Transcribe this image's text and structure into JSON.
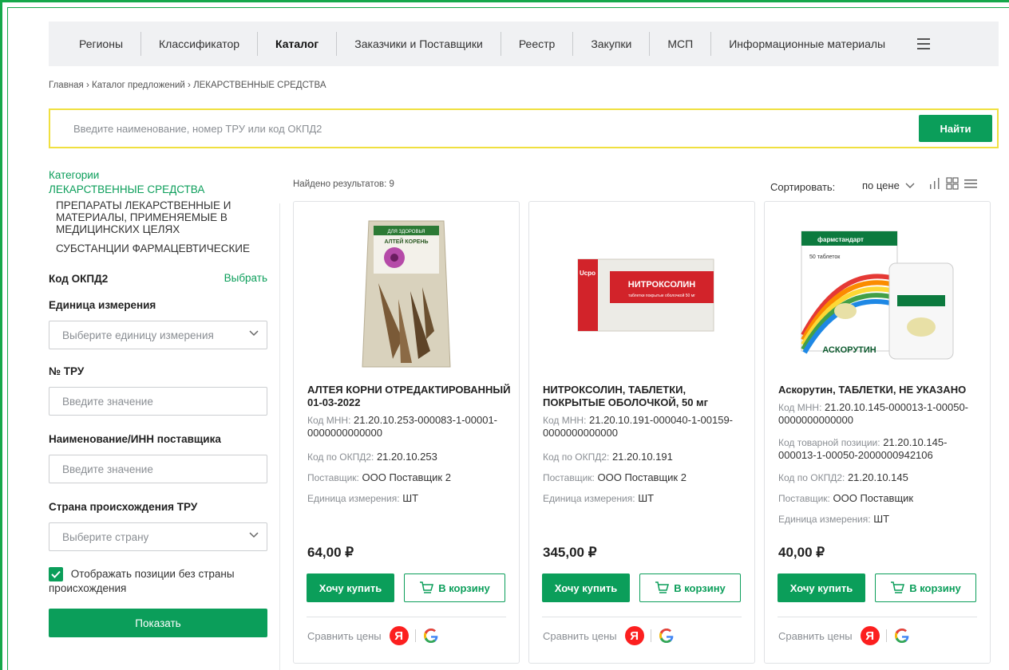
{
  "nav": {
    "items": [
      "Регионы",
      "Классификатор",
      "Каталог",
      "Заказчики и Поставщики",
      "Реестр",
      "Закупки",
      "МСП",
      "Информационные материалы"
    ]
  },
  "breadcrumb": "Главная › Каталог предложений › ЛЕКАРСТВЕННЫЕ СРЕДСТВА",
  "search": {
    "placeholder": "Введите наименование, номер ТРУ или код ОКПД2",
    "button": "Найти"
  },
  "sidebar": {
    "categories_title": "Категории",
    "category_main": "ЛЕКАРСТВЕННЫЕ СРЕДСТВА",
    "subcategories": [
      "ПРЕПАРАТЫ ЛЕКАРСТВЕННЫЕ И МАТЕРИАЛЫ, ПРИМЕНЯЕМЫЕ В МЕДИЦИНСКИХ ЦЕЛЯХ",
      "СУБСТАНЦИИ ФАРМАЦЕВТИЧЕСКИЕ"
    ],
    "okpd_label": "Код ОКПД2",
    "okpd_action": "Выбрать",
    "unit_label": "Единица измерения",
    "unit_placeholder": "Выберите единицу измерения",
    "tru_label": "№ ТРУ",
    "tru_placeholder": "Введите значение",
    "supplier_label": "Наименование/ИНН поставщика",
    "supplier_placeholder": "Введите значение",
    "country_label": "Страна происхождения ТРУ",
    "country_placeholder": "Выберите страну",
    "no_country_label": "Отображать позиции без страны происхождения",
    "show_button": "Показать"
  },
  "results": {
    "found": "Найдено результатов: 9",
    "sort_label": "Сортировать:",
    "sort_value": "по цене"
  },
  "products": [
    {
      "title": "АЛТЕЯ КОРНИ ОТРЕДАКТИРОВАННЫЙ 01-03-2022",
      "mnn_key": "Код МНН:",
      "mnn": "21.20.10.253-000083-1-00001-0000000000000",
      "okpd_key": "Код по ОКПД2:",
      "okpd": "21.20.10.253",
      "supplier_key": "Поставщик:",
      "supplier": "ООО Поставщик 2",
      "unit_key": "Единица измерения:",
      "unit": "ШТ",
      "price": "64,00 ₽",
      "pack_text": "АЛТЕЙ КОРЕНЬ",
      "pack_brand": "ДЛЯ ЗДОРОВЬЯ"
    },
    {
      "title": "НИТРОКСОЛИН, ТАБЛЕТКИ, ПОКРЫТЫЕ ОБОЛОЧКОЙ, 50 мг",
      "mnn_key": "Код МНН:",
      "mnn": "21.20.10.191-000040-1-00159-0000000000000",
      "okpd_key": "Код по ОКПД2:",
      "okpd": "21.20.10.191",
      "supplier_key": "Поставщик:",
      "supplier": "ООО Поставщик 2",
      "unit_key": "Единица измерения:",
      "unit": "ШТ",
      "price": "345,00 ₽",
      "pack_text": "НИТРОКСОЛИН",
      "pack_sub": "таблетки покрытые оболочкой  50 мг"
    },
    {
      "title": "Аскорутин, ТАБЛЕТКИ, НЕ УКАЗАНО",
      "mnn_key": "Код МНН:",
      "mnn": "21.20.10.145-000013-1-00050-0000000000000",
      "pos_key": "Код товарной позиции:",
      "pos": "21.20.10.145-000013-1-00050-2000000942106",
      "okpd_key": "Код по ОКПД2:",
      "okpd": "21.20.10.145",
      "supplier_key": "Поставщик:",
      "supplier": "ООО Поставщик",
      "unit_key": "Единица измерения:",
      "unit": "ШТ",
      "price": "40,00 ₽",
      "pack_text": "АСКОРУТИН",
      "pack_sub": "50 таблеток",
      "pack_brand": "фармстандарт"
    }
  ],
  "card_actions": {
    "buy": "Хочу купить",
    "cart": "В корзину",
    "compare": "Сравнить цены"
  },
  "colors": {
    "accent": "#0b9e5a",
    "frame": "#14a84a",
    "search_border": "#f0e040"
  }
}
